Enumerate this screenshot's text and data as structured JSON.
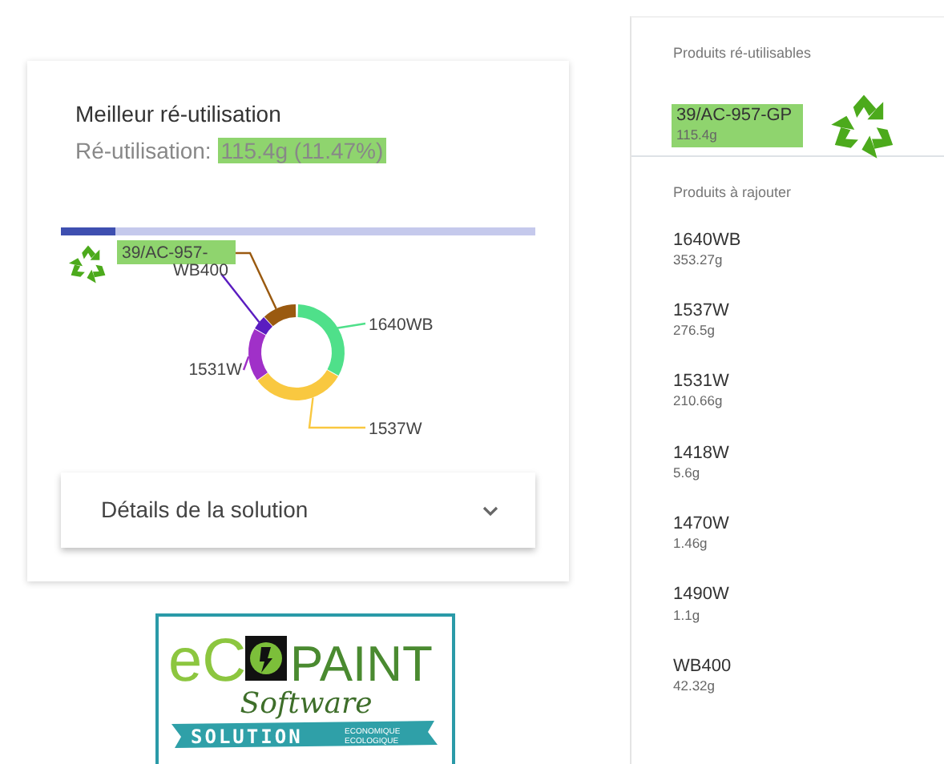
{
  "best_card": {
    "title": "Meilleur ré-utilisation",
    "reuse_label": "Ré-utilisation:",
    "reuse_value": {
      "text": "115.4g (11.47%)",
      "highlighted": true
    },
    "progress": {
      "level": 0.1147
    },
    "donut": {
      "slices": [
        {
          "label": "39/AC-957-",
          "color": "#9a5a10",
          "highlighted": true
        },
        {
          "label": "WB400",
          "color": "#5a1cc0",
          "highlighted": false
        },
        {
          "label": "1640WB",
          "color": "#4fe08a",
          "highlighted": false
        },
        {
          "label": "1531W",
          "color": "#a030c8",
          "highlighted": false
        },
        {
          "label": "1537W",
          "color": "#f9c840",
          "highlighted": false
        }
      ]
    },
    "details": {
      "title": "Détails de la solution",
      "expanded": false
    }
  },
  "panel": {
    "reusable_title": "Produits ré-utilisables",
    "reusable": [
      {
        "code": "39/AC-957-GP",
        "weight": "115.4g",
        "highlighted": true
      }
    ],
    "add_title": "Produits à rajouter",
    "to_add": [
      {
        "code": "1640WB",
        "weight": "353.27g"
      },
      {
        "code": "1537W",
        "weight": "276.5g"
      },
      {
        "code": "1531W",
        "weight": "210.66g"
      },
      {
        "code": "1418W",
        "weight": "5.6g"
      },
      {
        "code": "1470W",
        "weight": "1.46g"
      },
      {
        "code": "1490W",
        "weight": "1.1g"
      },
      {
        "code": "WB400",
        "weight": "42.32g"
      }
    ]
  },
  "logo": {
    "eco": "eC",
    "paint": "PAINT",
    "software": "Software",
    "solution": "SOLUTION",
    "tagline_1": "ECONOMIQUE",
    "tagline_2": "ECOLOGIQUE"
  }
}
